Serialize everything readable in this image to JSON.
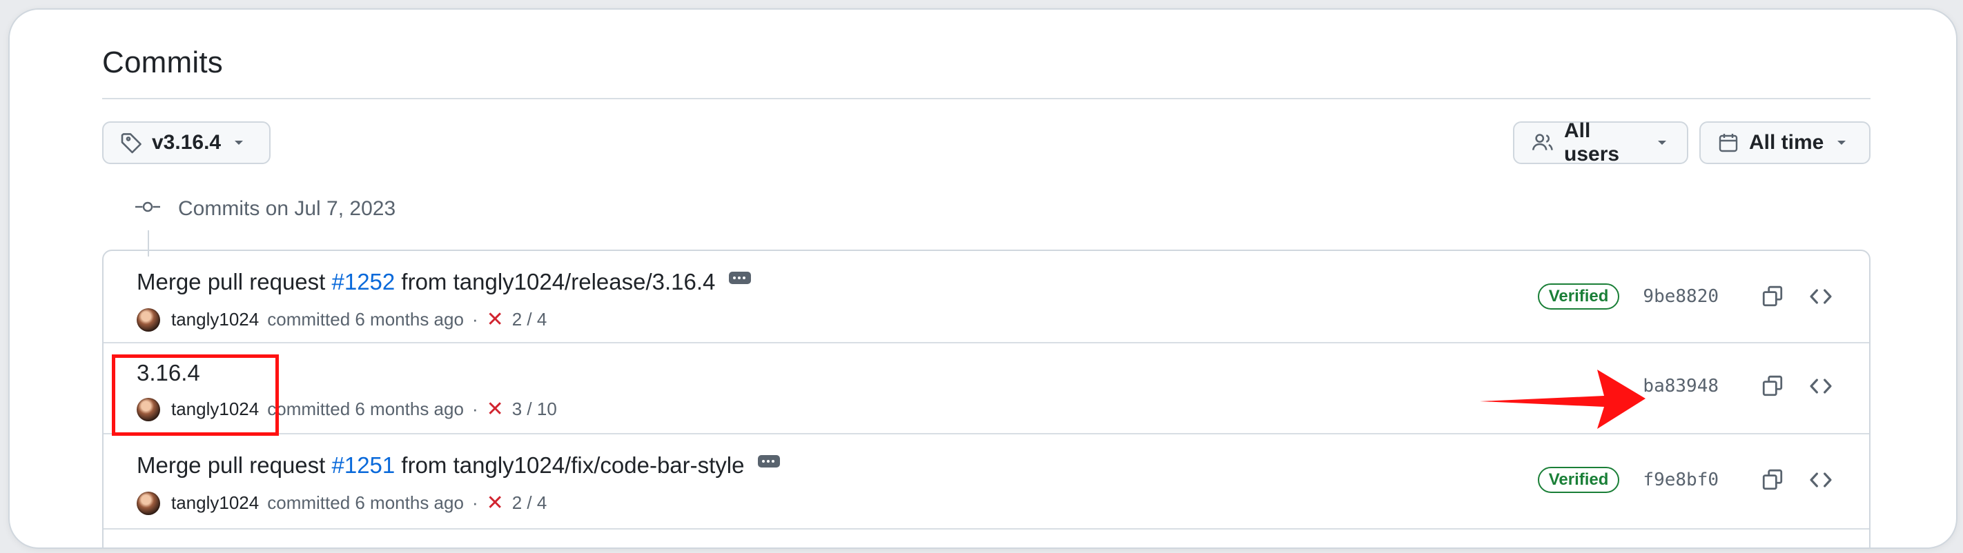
{
  "page": {
    "title": "Commits"
  },
  "filters": {
    "ref": {
      "label": "v3.16.4",
      "icon": "tag-icon"
    },
    "users": {
      "label": "All users",
      "icon": "people-icon"
    },
    "time": {
      "label": "All time",
      "icon": "calendar-icon"
    }
  },
  "day_group": {
    "label": "Commits on Jul 7, 2023"
  },
  "commits": [
    {
      "title_prefix": "Merge pull request ",
      "pr": "#1252",
      "title_suffix": " from tangly1024/release/3.16.4",
      "author": "tangly1024",
      "action": "committed 6 months ago",
      "separator": "·",
      "status_icon": "x-icon",
      "checks": "2 / 4",
      "verified": "Verified",
      "sha": "9be8820"
    },
    {
      "title": "3.16.4",
      "author": "tangly1024",
      "action": "committed 6 months ago",
      "separator": "·",
      "status_icon": "x-icon",
      "checks": "3 / 10",
      "sha": "ba83948"
    },
    {
      "title_prefix": "Merge pull request ",
      "pr": "#1251",
      "title_suffix": " from tangly1024/fix/code-bar-style",
      "author": "tangly1024",
      "action": "committed 6 months ago",
      "separator": "·",
      "status_icon": "x-icon",
      "checks": "2 / 4",
      "verified": "Verified",
      "sha": "f9e8bf0"
    }
  ],
  "colors": {
    "link": "#0969da",
    "verified": "#1a7f37",
    "fail": "#d1242f",
    "annotation": "#ff1111"
  }
}
